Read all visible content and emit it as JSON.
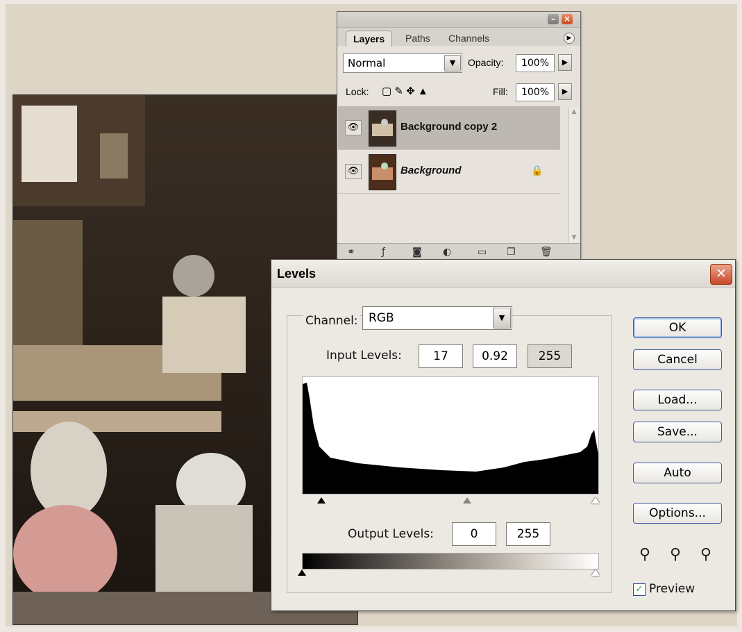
{
  "layers_panel": {
    "tabs": [
      "Layers",
      "Paths",
      "Channels"
    ],
    "blend_mode": "Normal",
    "opacity_label": "Opacity:",
    "opacity_value": "100%",
    "lock_label": "Lock:",
    "fill_label": "Fill:",
    "fill_value": "100%",
    "layers": [
      {
        "name": "Background copy 2",
        "selected": true,
        "locked": false
      },
      {
        "name": "Background",
        "selected": false,
        "locked": true
      }
    ]
  },
  "levels_dialog": {
    "title": "Levels",
    "channel_label": "Channel:",
    "channel_value": "RGB",
    "input_label": "Input Levels:",
    "input_values": [
      "17",
      "0.92",
      "255"
    ],
    "output_label": "Output Levels:",
    "output_values": [
      "0",
      "255"
    ],
    "buttons": {
      "ok": "OK",
      "cancel": "Cancel",
      "load": "Load...",
      "save": "Save...",
      "auto": "Auto",
      "options": "Options..."
    },
    "preview_label": "Preview",
    "preview_checked": true
  },
  "icons": {
    "eye": "eye-icon",
    "lock": "lock-icon",
    "eyedropper": "eyedropper-icon"
  }
}
